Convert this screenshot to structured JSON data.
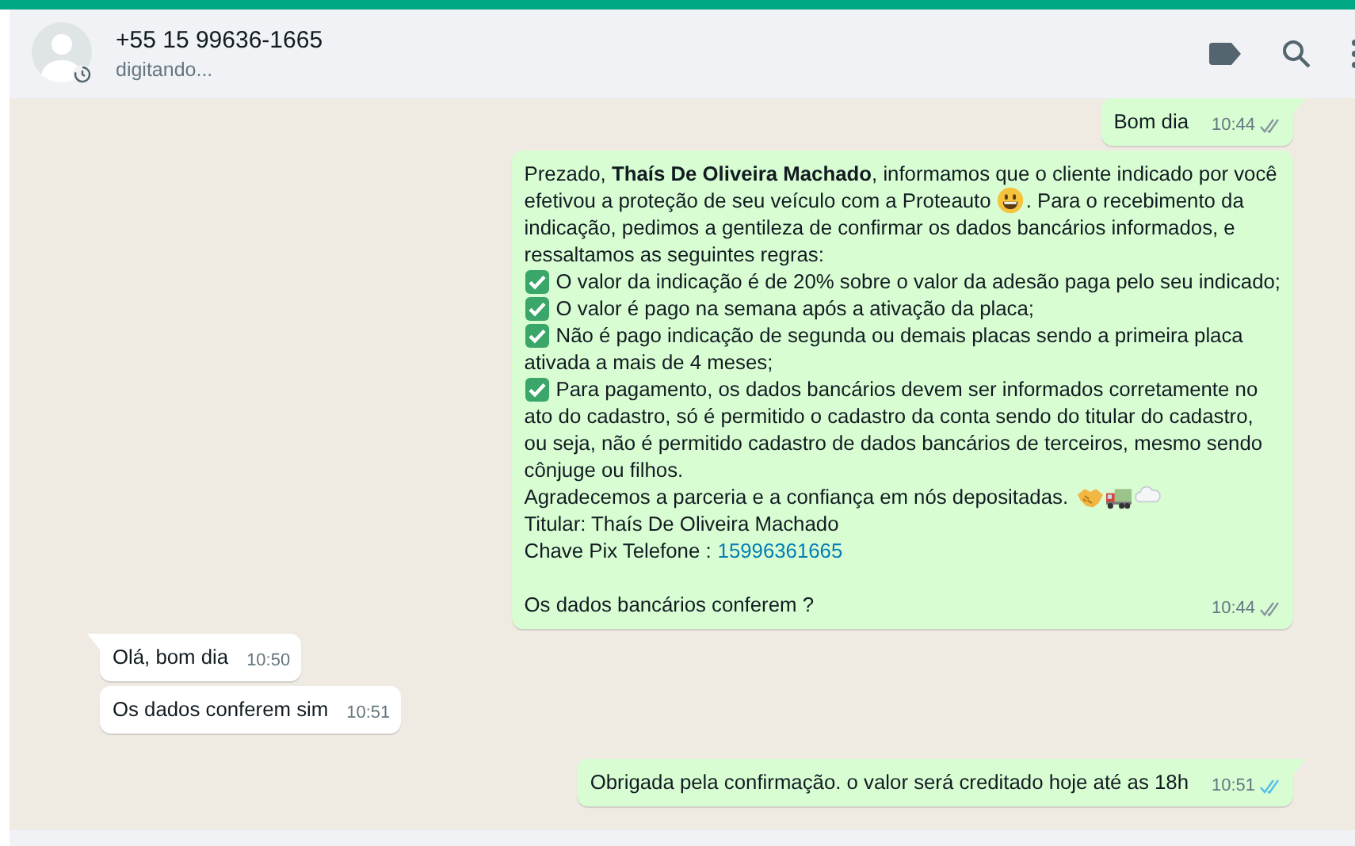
{
  "header": {
    "contact": "+55 15 99636-1665",
    "status": "digitando..."
  },
  "messages": [
    {
      "outgoing": true,
      "tail": true,
      "time": "10:44",
      "read": false,
      "lines": [
        {
          "kind": "plain",
          "segments": [
            {
              "kind": "text",
              "text": "Bom dia"
            }
          ]
        }
      ]
    },
    {
      "outgoing": true,
      "tail": false,
      "time": "10:44",
      "read": false,
      "lines": [
        {
          "kind": "plain",
          "segments": [
            {
              "kind": "text",
              "text": "Prezado, **Thaís De Oliveira Machado**, informamos que o cliente indicado por você"
            }
          ]
        },
        {
          "kind": "plain",
          "segments": [
            {
              "kind": "text",
              "text": "efetivou a proteção de seu veículo com a Proteauto"
            },
            {
              "kind": "smiley"
            },
            {
              "kind": "text",
              "text": ". Para o recebimento da"
            }
          ]
        },
        {
          "kind": "plain",
          "segments": [
            {
              "kind": "text",
              "text": "indicação, pedimos a gentileza de confirmar os dados bancários informados, e"
            }
          ]
        },
        {
          "kind": "plain",
          "segments": [
            {
              "kind": "text",
              "text": "ressaltamos as seguintes regras:"
            }
          ]
        },
        {
          "kind": "check",
          "segments": [
            {
              "kind": "text",
              "text": "O valor da indicação é de 20% sobre o valor da adesão paga pelo seu indicado;"
            }
          ]
        },
        {
          "kind": "check",
          "segments": [
            {
              "kind": "text",
              "text": "O valor é pago na semana após a ativação da placa;"
            }
          ]
        },
        {
          "kind": "check",
          "segments": [
            {
              "kind": "text",
              "text": "Não é pago indicação de segunda ou demais placas sendo a primeira placa"
            }
          ]
        },
        {
          "kind": "plain",
          "segments": [
            {
              "kind": "text",
              "text": "ativada a mais de 4 meses;"
            }
          ]
        },
        {
          "kind": "check",
          "segments": [
            {
              "kind": "text",
              "text": "Para pagamento, os dados bancários devem ser informados corretamente no"
            }
          ]
        },
        {
          "kind": "plain",
          "segments": [
            {
              "kind": "text",
              "text": "ato do cadastro, só é permitido o cadastro da conta sendo do titular do cadastro,"
            }
          ]
        },
        {
          "kind": "plain",
          "segments": [
            {
              "kind": "text",
              "text": "ou seja, não é permitido cadastro de dados bancários de terceiros, mesmo sendo"
            }
          ]
        },
        {
          "kind": "plain",
          "segments": [
            {
              "kind": "text",
              "text": "cônjuge ou filhos."
            }
          ]
        },
        {
          "kind": "plain",
          "segments": [
            {
              "kind": "text",
              "text": "Agradecemos a parceria e a confiança em nós depositadas."
            },
            {
              "kind": "handshake"
            },
            {
              "kind": "truck"
            },
            {
              "kind": "cloud"
            }
          ]
        },
        {
          "kind": "plain",
          "segments": [
            {
              "kind": "text",
              "text": "Titular: Thaís De Oliveira Machado"
            }
          ]
        },
        {
          "kind": "plain",
          "segments": [
            {
              "kind": "text",
              "text": "Chave Pix Telefone :"
            },
            {
              "kind": "link",
              "text": "15996361665"
            }
          ]
        },
        {
          "kind": "spaced",
          "segments": [
            {
              "kind": "text",
              "text": "Os dados bancários conferem ?"
            }
          ]
        }
      ]
    },
    {
      "outgoing": false,
      "tail": true,
      "time": "10:50",
      "lines": [
        {
          "kind": "plain",
          "segments": [
            {
              "kind": "text",
              "text": "Olá, bom dia"
            }
          ]
        }
      ]
    },
    {
      "outgoing": false,
      "tail": false,
      "time": "10:51",
      "lines": [
        {
          "kind": "plain",
          "segments": [
            {
              "kind": "text",
              "text": "Os dados conferem sim"
            }
          ]
        }
      ]
    },
    {
      "outgoing": true,
      "tail": true,
      "time": "10:51",
      "read": true,
      "lines": [
        {
          "kind": "plain",
          "segments": [
            {
              "kind": "text",
              "text": "Obrigada pela confirmação. o valor será creditado hoje até as 18h"
            }
          ]
        }
      ]
    }
  ]
}
